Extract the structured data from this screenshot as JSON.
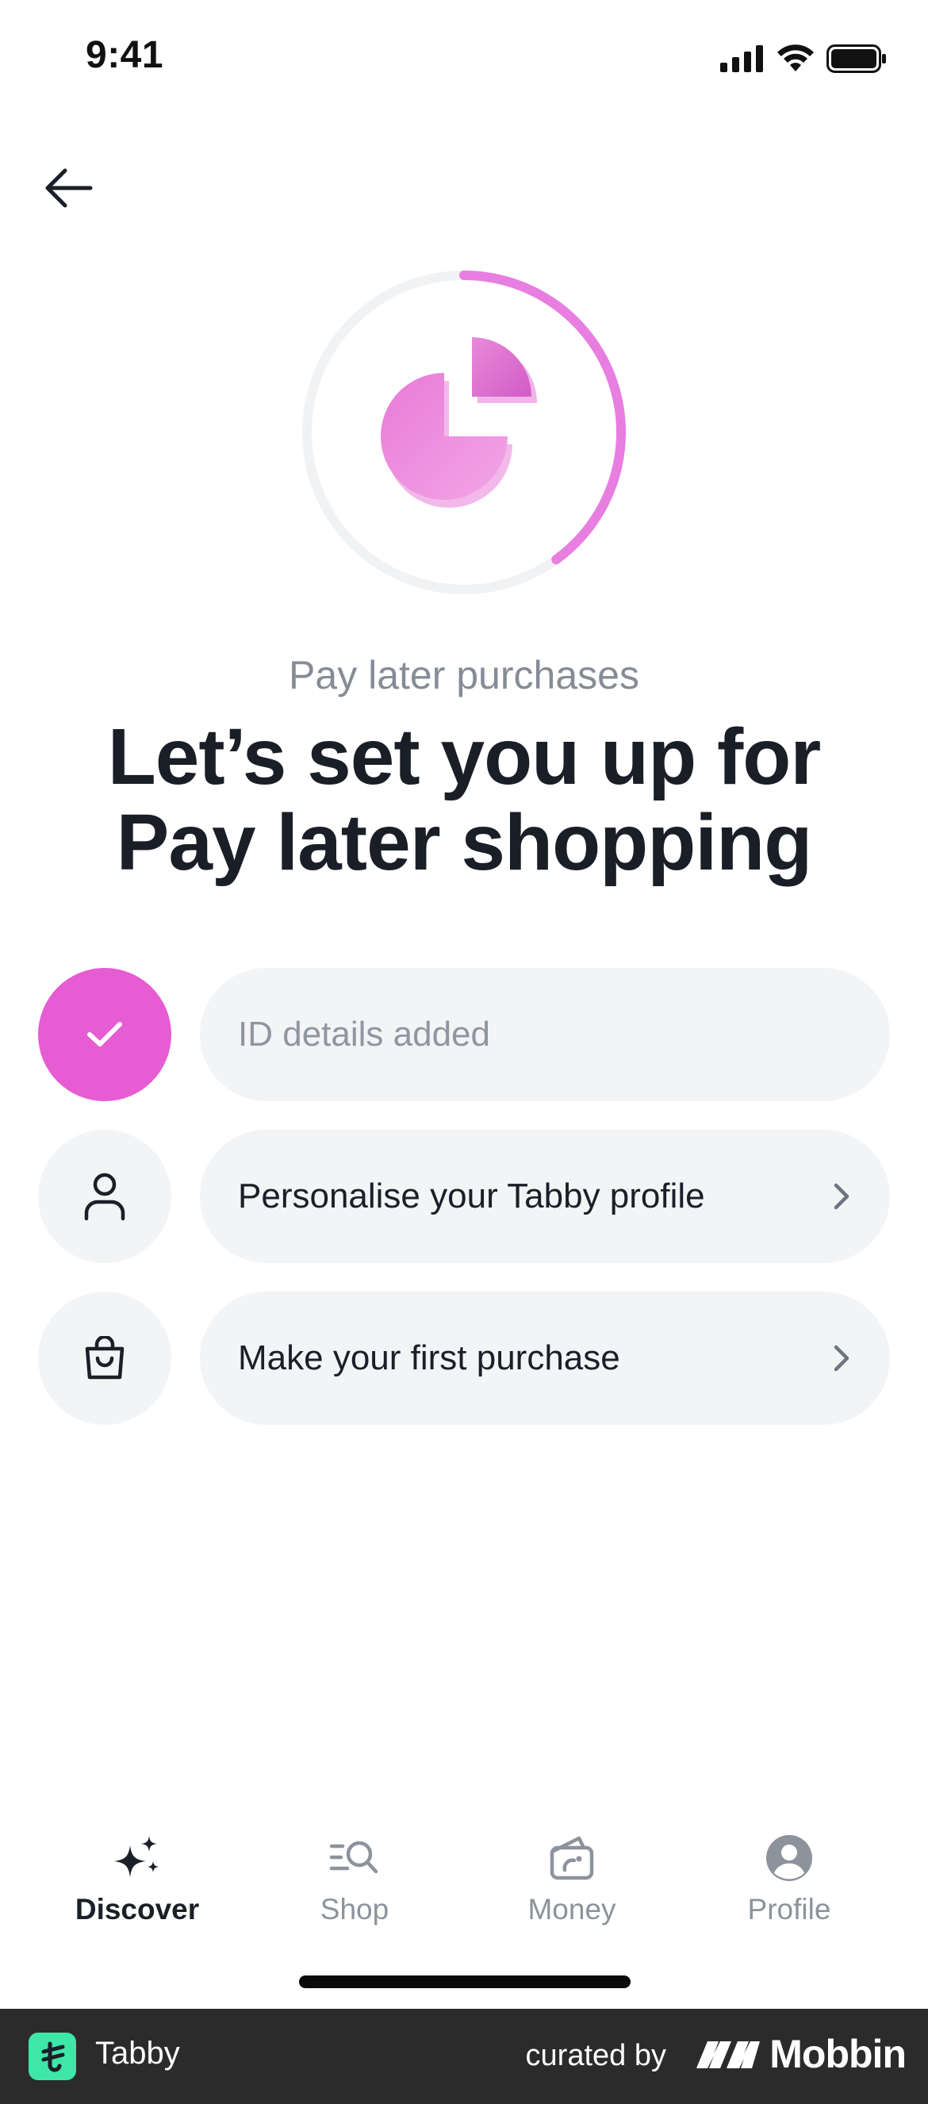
{
  "status_bar": {
    "time": "9:41"
  },
  "header": {
    "back_icon": "arrow-left-icon"
  },
  "hero": {
    "progress_fraction": 0.4,
    "ring_color": "#e77ee0",
    "ring_track_color": "#f1f2f4",
    "illustration": "pie-chart-illustration"
  },
  "subtitle": "Pay later purchases",
  "headline": {
    "line1": "Let’s set you up for",
    "line2": "Pay later shopping"
  },
  "steps": [
    {
      "label": "ID details added",
      "icon": "check-icon",
      "completed": true
    },
    {
      "label": "Personalise your Tabby profile",
      "icon": "person-icon",
      "completed": false
    },
    {
      "label": "Make your first purchase",
      "icon": "shopping-bag-icon",
      "completed": false
    }
  ],
  "tabbar": {
    "tabs": [
      {
        "label": "Discover",
        "icon": "sparkles-icon",
        "active": true
      },
      {
        "label": "Shop",
        "icon": "search-list-icon",
        "active": false
      },
      {
        "label": "Money",
        "icon": "wallet-icon",
        "active": false
      },
      {
        "label": "Profile",
        "icon": "profile-circle-icon",
        "active": false
      }
    ]
  },
  "footer": {
    "app_name": "Tabby",
    "curated_by": "curated by",
    "brand": "Mobbin"
  },
  "colors": {
    "accent": "#e65cd3",
    "pill_bg": "#f3f4f6",
    "muted_text": "#868c96",
    "footer_bg": "#2b2b2b",
    "tabby_green": "#3ee6a8"
  }
}
